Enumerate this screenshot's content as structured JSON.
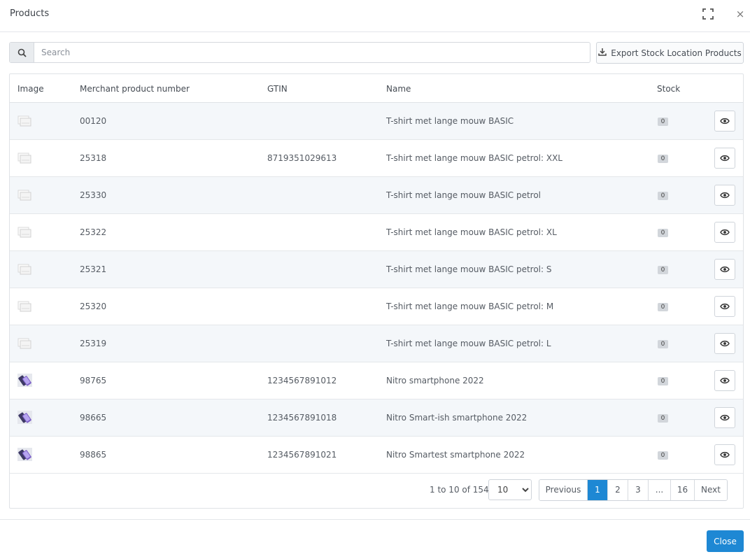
{
  "modal": {
    "title": "Products",
    "maximize_icon": "maximize-icon",
    "close_glyph": "×"
  },
  "search": {
    "icon": "search-icon",
    "placeholder": "Search",
    "value": ""
  },
  "export_button": {
    "icon": "download-icon",
    "label": "Export Stock Location Products"
  },
  "table": {
    "columns": [
      "Image",
      "Merchant product number",
      "GTIN",
      "Name",
      "Stock"
    ],
    "rows": [
      {
        "image": "placeholder-image-icon",
        "mpn": "00120",
        "gtin": "",
        "name": "T-shirt met lange mouw BASIC",
        "stock": "0"
      },
      {
        "image": "placeholder-image-icon",
        "mpn": "25318",
        "gtin": "8719351029613",
        "name": "T-shirt met lange mouw BASIC petrol: XXL",
        "stock": "0"
      },
      {
        "image": "placeholder-image-icon",
        "mpn": "25330",
        "gtin": "",
        "name": "T-shirt met lange mouw BASIC petrol",
        "stock": "0"
      },
      {
        "image": "placeholder-image-icon",
        "mpn": "25322",
        "gtin": "",
        "name": "T-shirt met lange mouw BASIC petrol: XL",
        "stock": "0"
      },
      {
        "image": "placeholder-image-icon",
        "mpn": "25321",
        "gtin": "",
        "name": "T-shirt met lange mouw BASIC petrol: S",
        "stock": "0"
      },
      {
        "image": "placeholder-image-icon",
        "mpn": "25320",
        "gtin": "",
        "name": "T-shirt met lange mouw BASIC petrol: M",
        "stock": "0"
      },
      {
        "image": "placeholder-image-icon",
        "mpn": "25319",
        "gtin": "",
        "name": "T-shirt met lange mouw BASIC petrol: L",
        "stock": "0"
      },
      {
        "image": "smartphone-thumbnail",
        "mpn": "98765",
        "gtin": "1234567891012",
        "name": "Nitro smartphone 2022",
        "stock": "0"
      },
      {
        "image": "smartphone-thumbnail",
        "mpn": "98665",
        "gtin": "1234567891018",
        "name": "Nitro Smart-ish smartphone 2022",
        "stock": "0"
      },
      {
        "image": "smartphone-thumbnail",
        "mpn": "98865",
        "gtin": "1234567891021",
        "name": "Nitro Smartest smartphone 2022",
        "stock": "0"
      }
    ],
    "row_action_icon": "eye-icon"
  },
  "pagination": {
    "summary": "1 to 10 of 154",
    "per_page": "10",
    "per_page_options": [
      "10"
    ],
    "previous_label": "Previous",
    "next_label": "Next",
    "pages": [
      "1",
      "2",
      "3",
      "...",
      "16"
    ],
    "active_page": "1"
  },
  "footer": {
    "close_label": "Close"
  },
  "colors": {
    "accent": "#1e88d4",
    "stripe": "#f4f7fa",
    "stock_badge": "#d2d6db"
  }
}
